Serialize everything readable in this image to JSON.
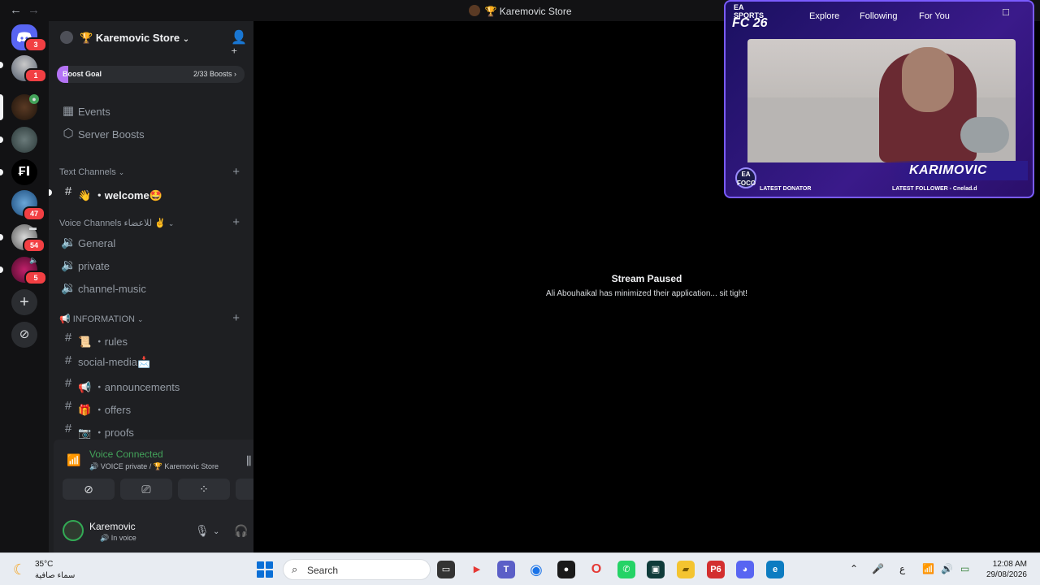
{
  "window": {
    "title": "Karemovic Store",
    "title_emoji": "🏆"
  },
  "rail": {
    "badges": [
      "3",
      "1",
      "47",
      "54",
      "5"
    ]
  },
  "guild": {
    "name": "Karemovic Store",
    "emoji": "🏆",
    "boost_label": "Boost Goal",
    "boost_count": "2/33 Boosts",
    "boost_progress": 0.0606
  },
  "nav": {
    "events": "Events",
    "server_boosts": "Server Boosts"
  },
  "categories": {
    "text": "Text Channels",
    "voice": "Voice Channels للاعضاء ✌️",
    "info": "INFORMATION"
  },
  "channels": {
    "welcome": "👋 ・welcome🤩",
    "voice": [
      "General",
      "private",
      "channel-music"
    ],
    "info": [
      "📜 ・rules",
      "social-media📩",
      "📢 ・announcements",
      "🎁 ・offers",
      "📷 ・proofs"
    ]
  },
  "voice_panel": {
    "status": "Voice Connected",
    "detail": "🔊 VOICE private / 🏆 Karemovic Store"
  },
  "user_panel": {
    "name": "Karemovic",
    "status": "In voice"
  },
  "stream": {
    "title": "Stream Paused",
    "message": "Ali Abouhaikal has minimized their application... sit tight!"
  },
  "overlay": {
    "tabs": [
      "Explore",
      "Following",
      "For You"
    ],
    "logo_top": "EA SPORTS",
    "logo_main": "FC 26",
    "streamer": "KARIMOVIC",
    "badge": "EA FOCO",
    "latest_donator": "LATEST DONATOR",
    "latest_follower": "LATEST FOLLOWER - Cnelad.d"
  },
  "taskbar": {
    "temperature": "35°C",
    "weather": "سماء صافية",
    "search_placeholder": "Search",
    "lang": "ع",
    "time": "12:08 AM",
    "date": "29/08/2026"
  },
  "colors": {
    "accent_green": "#43a25a",
    "badge_red": "#f23f43",
    "boost_purple": "#b473f5"
  }
}
